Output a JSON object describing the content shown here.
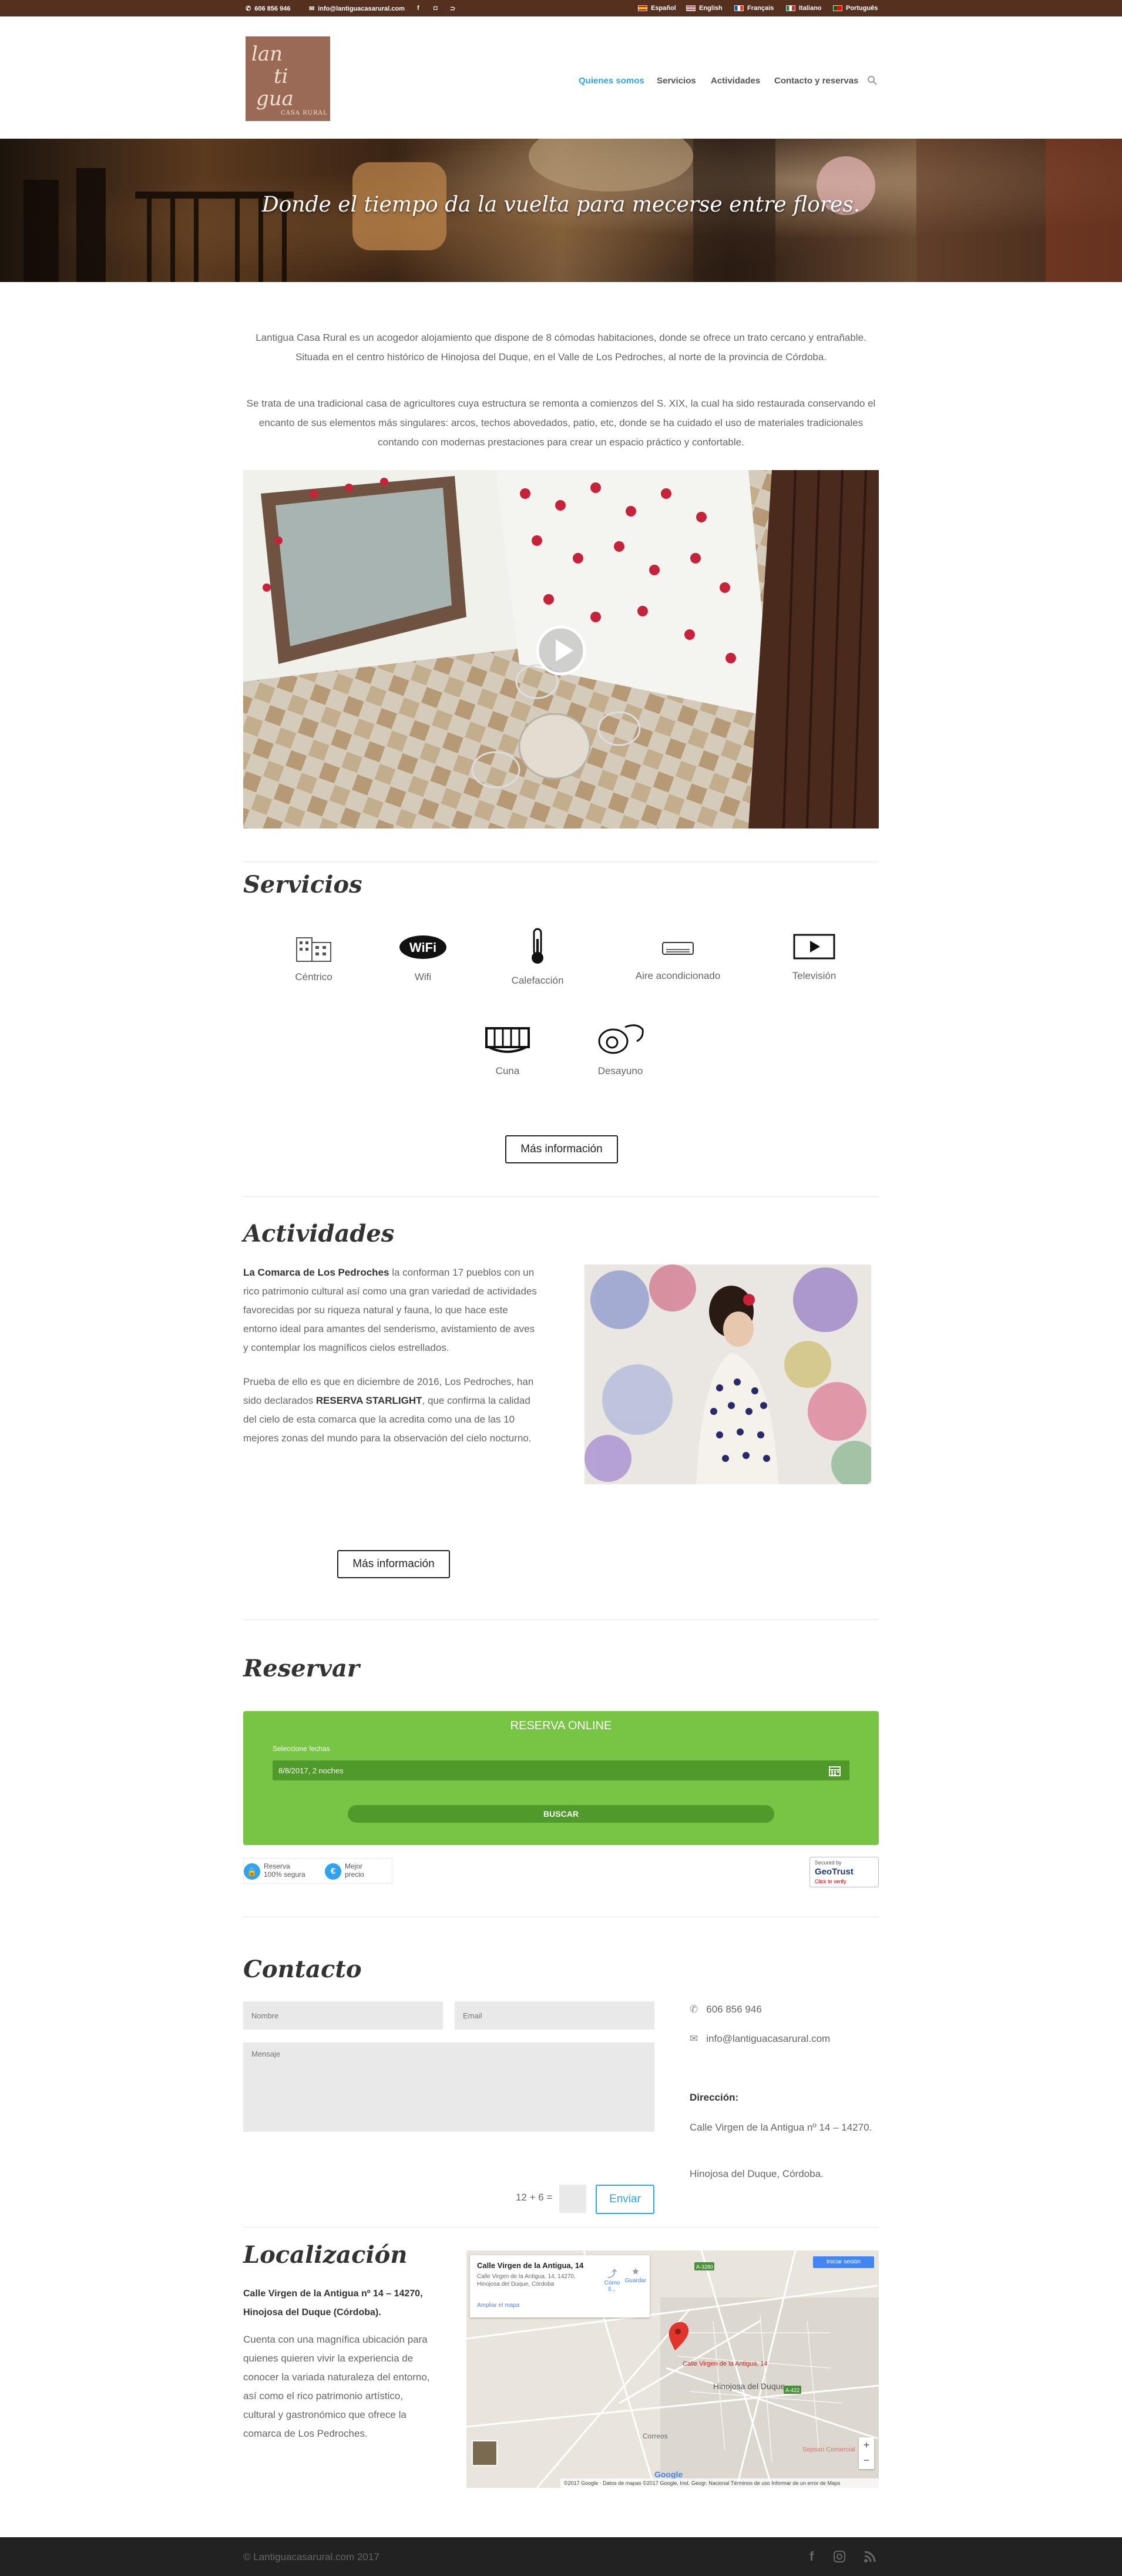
{
  "topbar": {
    "phone": "606 856 946",
    "email": "info@lantiguacasarural.com",
    "languages": [
      "Español",
      "English",
      "Français",
      "Italiano",
      "Português"
    ]
  },
  "logo": {
    "line1": "lan",
    "line2": "ti",
    "line3": "gua",
    "tagline": "CASA RURAL"
  },
  "nav": {
    "items": [
      "Quienes somos",
      "Servicios",
      "Actividades",
      "Contacto y reservas"
    ],
    "active_color": "#2ea3f2"
  },
  "hero": {
    "caption": "Donde el tiempo da la vuelta para mecerse entre flores."
  },
  "intro": {
    "p1": "Lantigua Casa Rural es un acogedor alojamiento que dispone de 8 cómodas habitaciones, donde se ofrece un trato cercano y entrañable. Situada en el centro histórico de Hinojosa del Duque, en el Valle de Los Pedroches, al norte de la provincia de Córdoba.",
    "p2": "Se trata de una tradicional casa de agricultores cuya estructura se remonta a comienzos del S. XIX, la cual ha sido restaurada conservando el encanto de sus elementos más singulares: arcos, techos abovedados, patio, etc, donde se ha cuidado el uso de materiales tradicionales contando con modernas prestaciones para crear un espacio práctico y confortable."
  },
  "servicios": {
    "title": "Servicios",
    "items": [
      {
        "label": "Céntrico",
        "icon": "building-icon"
      },
      {
        "label": "Wifi",
        "icon": "wifi-icon"
      },
      {
        "label": "Calefacción",
        "icon": "thermometer-icon"
      },
      {
        "label": "Aire acondicionado",
        "icon": "air-conditioner-icon"
      },
      {
        "label": "Televisión",
        "icon": "tv-icon"
      },
      {
        "label": "Cuna",
        "icon": "crib-icon"
      },
      {
        "label": "Desayuno",
        "icon": "breakfast-icon"
      }
    ],
    "button": "Más información"
  },
  "actividades": {
    "title": "Actividades",
    "p1_bold": "La Comarca de Los Pedroches",
    "p1_rest": " la conforman 17 pueblos con un rico patrimonio cultural así como una gran variedad de actividades favorecidas por su riqueza natural y fauna, lo que hace este entorno ideal para amantes del senderismo, avistamiento de aves y contemplar los magníficos cielos estrellados.",
    "p2_pre": "Prueba de ello es que en diciembre de 2016, Los Pedroches, han sido declarados ",
    "p2_bold": "RESERVA STARLIGHT",
    "p2_post": ", que confirma la calidad del cielo de esta comarca que la acredita como una de las 10 mejores zonas del mundo para la observación del cielo nocturno.",
    "button": "Más información"
  },
  "reservar": {
    "title": "Reservar",
    "widget_title": "RESERVA ONLINE",
    "dates_label": "Seleccione fechas",
    "dates_value": "8/8/2017, 2 noches",
    "search_button": "BUSCAR",
    "badge1_line1": "Reserva",
    "badge1_line2": "100% segura",
    "badge2_line1": "Mejor",
    "badge2_line2": "precio",
    "geotrust_line1": "Secured by",
    "geotrust_line2": "GeoTrust",
    "geotrust_line3": "Click to verify",
    "green": "#78c444"
  },
  "contacto": {
    "title": "Contacto",
    "name_placeholder": "Nombre",
    "email_placeholder": "Email",
    "message_placeholder": "Mensaje",
    "captcha": "12 + 6 =",
    "submit": "Enviar",
    "phone": "606 856 946",
    "email": "info@lantiguacasarural.com",
    "address_label": "Dirección:",
    "address_line": "Calle Virgen de la Antigua nº 14 – 14270.",
    "city_line": "Hinojosa del Duque, Córdoba."
  },
  "localizacion": {
    "title": "Localización",
    "address_bold": "Calle Virgen de la Antigua nº 14 – 14270, Hinojosa del Duque (Córdoba).",
    "text": "Cuenta con una magnífica ubicación para quienes quieren vivir la experiencia de conocer la variada naturaleza del entorno, así como el rico patrimonio artístico, cultural y gastronómico que ofrece la comarca de Los Pedroches.",
    "map": {
      "card_title": "Calle Virgen de la Antigua, 14",
      "card_address": "Calle Virgen de la Antigua, 14, 14270, Hinojosa del Duque, Córdoba",
      "directions": "Cómo ll...",
      "save": "Guardar",
      "enlarge": "Ampliar el mapa",
      "signin": "Iniciar sesión",
      "pin_label": "Calle Virgen de la Antigua, 14",
      "town_label": "Hinojosa del Duque",
      "correos": "Correos",
      "sepsa": "Sepsan Comercial",
      "attribution": "©2017 Google · Datos de mapas ©2017 Google, Inst. Geogr. Nacional   Términos de uso   Informar de un error de Maps",
      "google": "Google",
      "road1": "A-3280",
      "road2": "A-422"
    }
  },
  "footer": {
    "copyright": "© Lantiguacasarural.com 2017"
  }
}
